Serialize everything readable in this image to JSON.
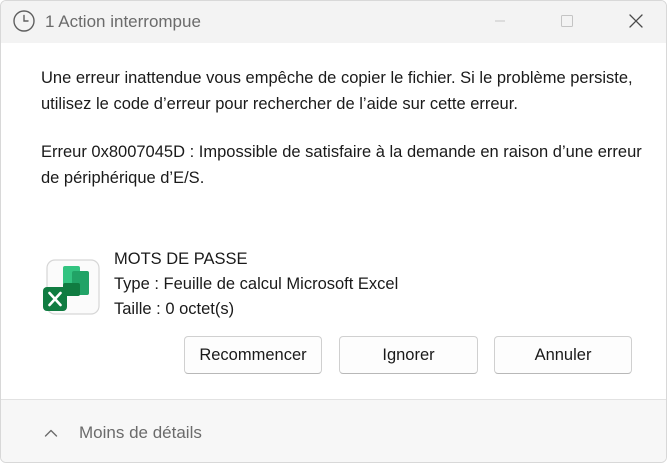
{
  "window": {
    "title": "1 Action interrompue",
    "icons": {
      "title": "clock-icon",
      "minimize": "minimize-icon",
      "maximize": "maximize-icon",
      "close": "close-icon"
    }
  },
  "message": {
    "text": "Une erreur inattendue vous empêche de copier le fichier. Si le problème persiste, utilisez le code d’erreur pour rechercher de l’aide sur cette erreur.",
    "error": "Erreur 0x8007045D : Impossible de satisfaire à la demande en raison d’une erreur de périphérique d’E/S."
  },
  "file": {
    "icon": "excel-file-icon",
    "name": "MOTS DE PASSE",
    "type": "Type : Feuille de calcul Microsoft Excel",
    "size": "Taille : 0 octet(s)"
  },
  "buttons": {
    "retry": "Recommencer",
    "skip": "Ignorer",
    "cancel": "Annuler"
  },
  "footer": {
    "details_label": "Moins de détails",
    "icon": "chevron-up-icon"
  },
  "colors": {
    "titlebar": "#f3f3f3",
    "footer": "#f7f7f7",
    "excel_dark": "#107c41",
    "excel_light": "#21a366"
  }
}
